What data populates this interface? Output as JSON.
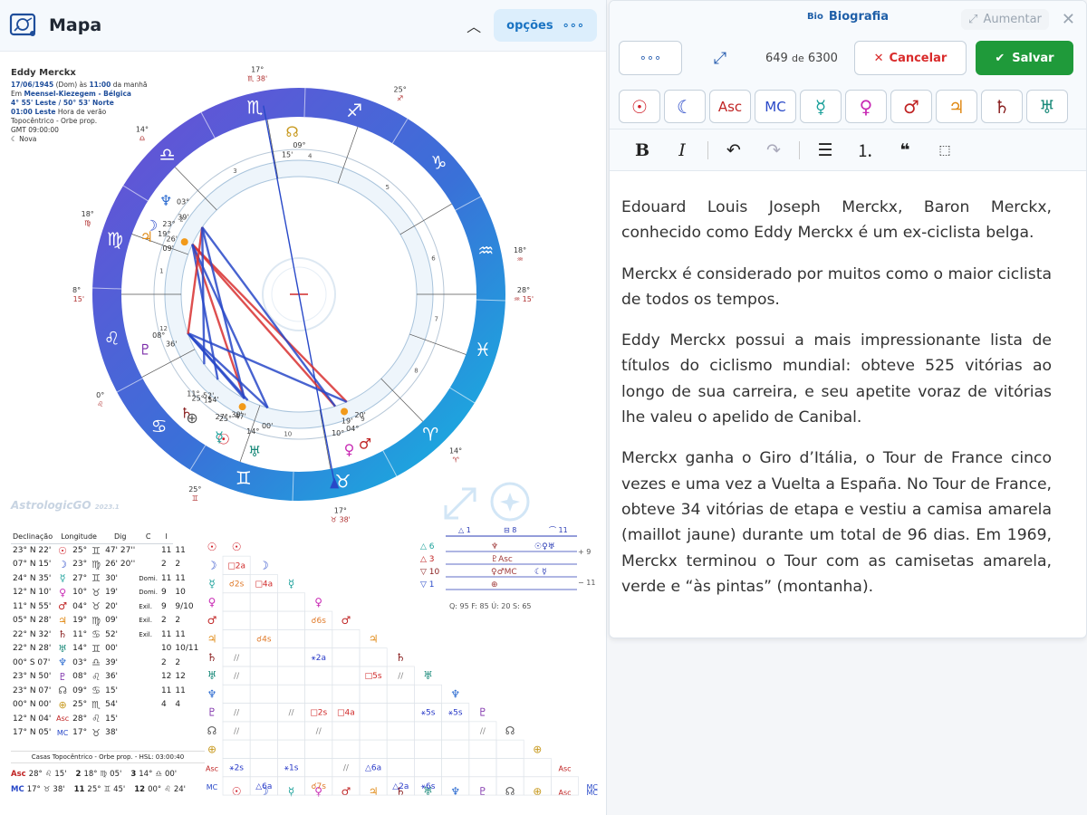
{
  "header": {
    "title": "Mapa",
    "options_label": "opções"
  },
  "person": {
    "name": "Eddy Merckx",
    "line1_date": "17/06/1945",
    "line1_day": "(Dom) às",
    "line1_time": "11:00",
    "line1_rest": "da manhã",
    "line2_pre": "Em",
    "line2_place": "Meensel-Kiezegem - Bélgica",
    "line3": "4° 55' Leste / 50° 53' Norte",
    "line4_time": "01:00 Leste",
    "line4_rest": "Hora de verão",
    "line5": "Topocêntrico - Orbe prop.",
    "line6": "GMT 09:00:00",
    "line7": "Nova"
  },
  "wheel": {
    "cusp_labels": [
      {
        "deg": "17°",
        "glyph": "♉",
        "min": "38'"
      },
      {
        "deg": "25°",
        "glyph": "♊",
        "min": ""
      },
      {
        "deg": "14°",
        "glyph": "♈",
        "min": ""
      },
      {
        "deg": "18°",
        "glyph": "♒",
        "min": ""
      },
      {
        "deg": "28°",
        "glyph": "♒",
        "min": "15'"
      },
      {
        "deg": "28°",
        "glyph": "♌",
        "min": "15'"
      },
      {
        "deg": "18°",
        "glyph": "♍",
        "min": ""
      },
      {
        "deg": "14°",
        "glyph": "♎",
        "min": ""
      },
      {
        "deg": "17°",
        "glyph": "♏",
        "min": "38'"
      },
      {
        "deg": "25°",
        "glyph": "♐",
        "min": ""
      },
      {
        "deg": "0°",
        "glyph": "♌",
        "min": ""
      }
    ],
    "planet_labels": [
      {
        "glyph": "☉",
        "deg": "25°",
        "min": "47'"
      },
      {
        "glyph": "♅",
        "deg": "14°",
        "min": "00'"
      },
      {
        "glyph": "♀",
        "deg": "10°",
        "min": "19'"
      },
      {
        "glyph": "♂",
        "deg": "04°",
        "min": "20'"
      },
      {
        "glyph": "☿",
        "deg": "27°",
        "min": "30'"
      },
      {
        "glyph": "♄",
        "deg": "11°",
        "min": "52'"
      },
      {
        "glyph": "♇",
        "deg": "08°",
        "min": "36'"
      },
      {
        "glyph": "♃",
        "deg": "19°",
        "min": "09'"
      },
      {
        "glyph": "☽",
        "deg": "23°",
        "min": "26'"
      },
      {
        "glyph": "♆",
        "deg": "03°",
        "min": "39'"
      },
      {
        "glyph": "⊕",
        "deg": "25°",
        "min": "54'"
      },
      {
        "glyph": "☊",
        "deg": "09°",
        "min": "15'"
      }
    ]
  },
  "watermark": {
    "brand": "AstrologicGO",
    "version": "2023.1"
  },
  "positions": {
    "headers": [
      "Declinação",
      "Longitude",
      "Dig",
      "C",
      "I"
    ],
    "rows": [
      {
        "dec": "23° N 22'",
        "glyph": "☉",
        "lon": "25°",
        "sign": "♊",
        "lonmin": "47' 27''",
        "dig": "",
        "c": "11",
        "i": "11",
        "color": "#d0202a"
      },
      {
        "dec": "07° N 15'",
        "glyph": "☽",
        "lon": "23°",
        "sign": "♍",
        "lonmin": "26' 20''",
        "dig": "",
        "c": "2",
        "i": "2",
        "color": "#2848c8"
      },
      {
        "dec": "24° N 35'",
        "glyph": "☿",
        "lon": "27°",
        "sign": "♊",
        "lonmin": "30'",
        "dig": "Domi.",
        "c": "11",
        "i": "11",
        "color": "#1aa09a"
      },
      {
        "dec": "12° N 10'",
        "glyph": "♀",
        "lon": "10°",
        "sign": "♉",
        "lonmin": "19'",
        "dig": "Domi.",
        "c": "9",
        "i": "10",
        "color": "#c82ab4"
      },
      {
        "dec": "11° N 55'",
        "glyph": "♂",
        "lon": "04°",
        "sign": "♉",
        "lonmin": "20'",
        "dig": "Exil.",
        "c": "9",
        "i": "9/10",
        "color": "#c02424"
      },
      {
        "dec": "05° N 28'",
        "glyph": "♃",
        "lon": "19°",
        "sign": "♍",
        "lonmin": "09'",
        "dig": "Exil.",
        "c": "2",
        "i": "2",
        "color": "#e08a16"
      },
      {
        "dec": "22° N 32'",
        "glyph": "♄",
        "lon": "11°",
        "sign": "♋",
        "lonmin": "52'",
        "dig": "Exil.",
        "c": "11",
        "i": "11",
        "color": "#8a2020"
      },
      {
        "dec": "22° N 28'",
        "glyph": "♅",
        "lon": "14°",
        "sign": "♊",
        "lonmin": "00'",
        "dig": "",
        "c": "10",
        "i": "10/11",
        "color": "#1a8a7a"
      },
      {
        "dec": "00° S 07'",
        "glyph": "♆",
        "lon": "03°",
        "sign": "♎",
        "lonmin": "39'",
        "dig": "",
        "c": "2",
        "i": "2",
        "color": "#2a6ad0"
      },
      {
        "dec": "23° N 50'",
        "glyph": "♇",
        "lon": "08°",
        "sign": "♌",
        "lonmin": "36'",
        "dig": "",
        "c": "12",
        "i": "12",
        "color": "#7a2aa8"
      },
      {
        "dec": "23° N 07'",
        "glyph": "☊",
        "lon": "09°",
        "sign": "♋",
        "lonmin": "15'",
        "dig": "",
        "c": "11",
        "i": "11",
        "color": "#555555"
      },
      {
        "dec": "00° N 00'",
        "glyph": "⊕",
        "lon": "25°",
        "sign": "♏",
        "lonmin": "54'",
        "dig": "",
        "c": "4",
        "i": "4",
        "color": "#c89a20"
      },
      {
        "dec": "12° N 04'",
        "glyph": "Asc",
        "lon": "28°",
        "sign": "♌",
        "lonmin": "15'",
        "dig": "",
        "c": "",
        "i": "",
        "color": "#c02424"
      },
      {
        "dec": "17° N 05'",
        "glyph": "MC",
        "lon": "17°",
        "sign": "♉",
        "lonmin": "38'",
        "dig": "",
        "c": "",
        "i": "",
        "color": "#2848c8"
      }
    ]
  },
  "casas": {
    "caption": "Casas Topocêntrico - Orbe prop. - HSL: 03:00:40",
    "row1": [
      {
        "n": "Asc",
        "deg": "28°",
        "sign": "♌",
        "min": "15'"
      },
      {
        "n": "2",
        "deg": "18°",
        "sign": "♍",
        "min": "05'"
      },
      {
        "n": "3",
        "deg": "14°",
        "sign": "♎",
        "min": "00'"
      }
    ],
    "row2": [
      {
        "n": "MC",
        "deg": "17°",
        "sign": "♉",
        "min": "38'"
      },
      {
        "n": "11",
        "deg": "25°",
        "sign": "♊",
        "min": "45'"
      },
      {
        "n": "12",
        "deg": "00°",
        "sign": "♌",
        "min": "24'"
      }
    ]
  },
  "aspect_grid": {
    "glyphs": [
      "☉",
      "☽",
      "☿",
      "♀",
      "♂",
      "♃",
      "♄",
      "♅",
      "♆",
      "♇",
      "☊",
      "⊕",
      "Asc",
      "MC"
    ],
    "cells": [
      {
        "r": 1,
        "c": 0,
        "t": "□2a",
        "k": "r"
      },
      {
        "r": 2,
        "c": 0,
        "t": "☌2s",
        "k": "o"
      },
      {
        "r": 2,
        "c": 1,
        "t": "□4a",
        "k": "r"
      },
      {
        "r": 4,
        "c": 3,
        "t": "☌6s",
        "k": "o"
      },
      {
        "r": 5,
        "c": 1,
        "t": "☌4s",
        "k": "o"
      },
      {
        "r": 6,
        "c": 0,
        "t": "//",
        "k": "g"
      },
      {
        "r": 6,
        "c": 3,
        "t": "⚹2a",
        "k": "b"
      },
      {
        "r": 7,
        "c": 0,
        "t": "//",
        "k": "g"
      },
      {
        "r": 7,
        "c": 5,
        "t": "□5s",
        "k": "r"
      },
      {
        "r": 7,
        "c": 6,
        "t": "//",
        "k": "g"
      },
      {
        "r": 9,
        "c": 0,
        "t": "//",
        "k": "g"
      },
      {
        "r": 9,
        "c": 2,
        "t": "//",
        "k": "g"
      },
      {
        "r": 9,
        "c": 3,
        "t": "□2s",
        "k": "r"
      },
      {
        "r": 9,
        "c": 4,
        "t": "□4a",
        "k": "r"
      },
      {
        "r": 9,
        "c": 7,
        "t": "⚹5s",
        "k": "b"
      },
      {
        "r": 9,
        "c": 8,
        "t": "⚹5s",
        "k": "b"
      },
      {
        "r": 10,
        "c": 0,
        "t": "//",
        "k": "g"
      },
      {
        "r": 10,
        "c": 3,
        "t": "//",
        "k": "g"
      },
      {
        "r": 10,
        "c": 9,
        "t": "//",
        "k": "g"
      },
      {
        "r": 12,
        "c": 0,
        "t": "⚹2s",
        "k": "b"
      },
      {
        "r": 12,
        "c": 2,
        "t": "⚹1s",
        "k": "b"
      },
      {
        "r": 12,
        "c": 4,
        "t": "//",
        "k": "g"
      },
      {
        "r": 12,
        "c": 5,
        "t": "△6a",
        "k": "b"
      },
      {
        "r": 13,
        "c": 1,
        "t": "△6a",
        "k": "b"
      },
      {
        "r": 13,
        "c": 3,
        "t": "☌7s",
        "k": "o"
      },
      {
        "r": 13,
        "c": 6,
        "t": "△2a",
        "k": "b"
      },
      {
        "r": 13,
        "c": 7,
        "t": "⚹6s",
        "k": "b"
      }
    ]
  },
  "elements": {
    "top": [
      "△ 1",
      "⊟ 8",
      "⌒ 11"
    ],
    "rows": [
      {
        "l": "△ 6",
        "c": "♆",
        "r": "☉♀♅"
      },
      {
        "l": "△ 3",
        "c": "♇Asc",
        "r": ""
      },
      {
        "l": "▽ 10",
        "c": "♀♂MC",
        "r": "☾☿"
      },
      {
        "l": "▽ 1",
        "c": "⊕",
        "r": ""
      }
    ],
    "side": [
      "+ 9",
      "− 11"
    ],
    "totals": "Q: 95   F: 85   Ú: 20   S: 65"
  },
  "editor": {
    "title_badge": "Bio",
    "title": "Biografia",
    "expand_label": "Aumentar",
    "counter_a": "649",
    "counter_sep": "de",
    "counter_b": "6300",
    "cancel_label": "Cancelar",
    "save_label": "Salvar",
    "planet_buttons": [
      "☉",
      "☾",
      "Asc",
      "MC",
      "☿",
      "♀",
      "♂",
      "♃",
      "♄",
      "♅"
    ],
    "planet_colors": [
      "#d0202a",
      "#2848c8",
      "#c02424",
      "#2848c8",
      "#1aa09a",
      "#c82ab4",
      "#c02424",
      "#e08a16",
      "#8a2020",
      "#1a8a7a"
    ],
    "paragraphs": [
      "Edouard Louis Joseph Merckx, Baron Merckx, conhecido como Eddy Merckx é um ex-ciclista belga.",
      "Merckx é considerado por muitos como o maior ciclista de todos os tempos.",
      "Eddy Merckx possui a mais impressionante lista de títulos do ciclismo mundial: obteve 525 vitórias ao longo de sua carreira, e seu apetite voraz de vitórias lhe valeu o apelido de Canibal.",
      "Merckx ganha o Giro d’Itália, o Tour de France cinco vezes e uma vez a Vuelta a España. No Tour de France, obteve 34 vitórias de etapa e vestiu a camisa amarela (maillot jaune) durante um total de 96 dias. Em 1969, Merckx terminou o Tour com as camisetas amarela, verde e “às pintas” (montanha)."
    ]
  }
}
